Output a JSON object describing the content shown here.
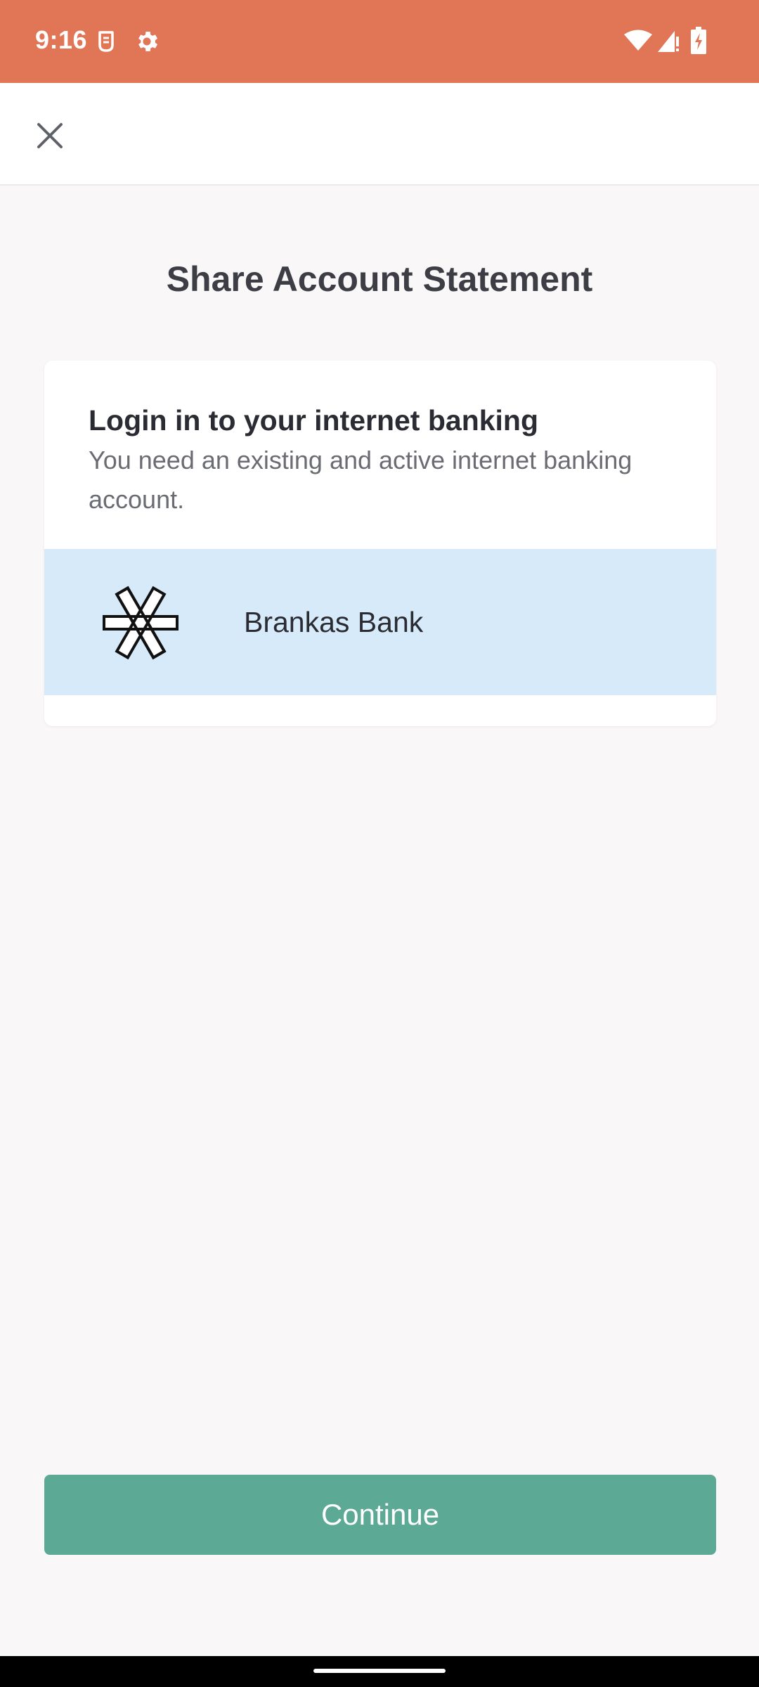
{
  "status_bar": {
    "time": "9:16",
    "background_color": "#e07655",
    "icons": [
      "notification-app-icon",
      "settings-gear-icon",
      "wifi-icon",
      "cell-signal-icon",
      "battery-charging-icon"
    ]
  },
  "top_bar": {
    "close_icon": "close-icon"
  },
  "page": {
    "title": "Share Account Statement"
  },
  "card": {
    "heading": "Login in to your internet banking",
    "subtitle": "You need an existing and active internet banking account.",
    "bank": {
      "name": "Brankas Bank",
      "logo_icon": "brankas-asterisk-logo",
      "highlight_color": "#d6eaf9"
    }
  },
  "footer": {
    "continue_label": "Continue",
    "button_color": "#5ca996"
  }
}
